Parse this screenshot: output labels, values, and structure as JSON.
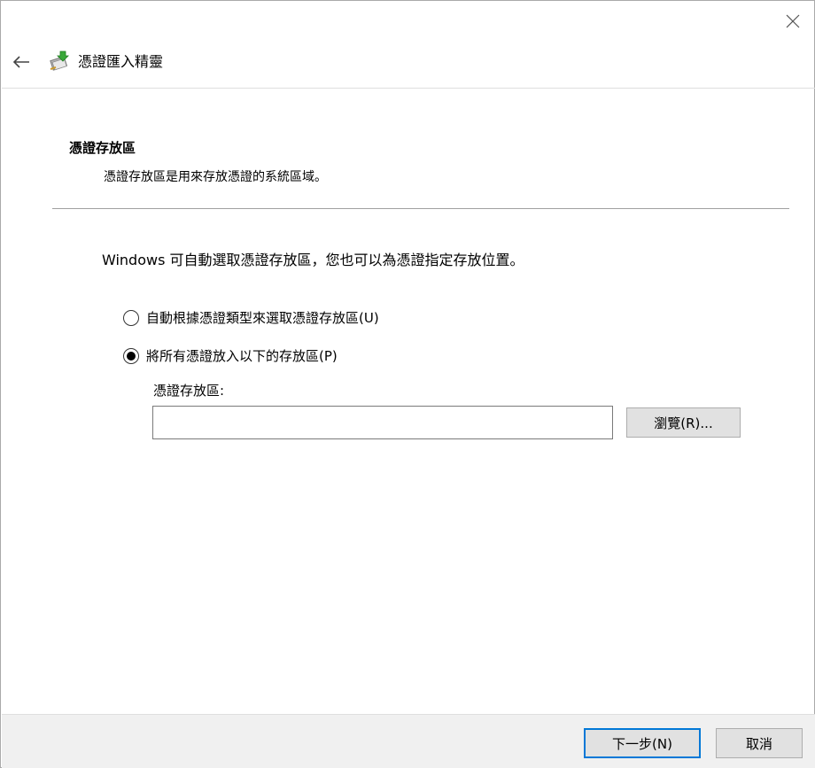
{
  "window": {
    "title": "憑證匯入精靈",
    "icons": {
      "close": "close-icon",
      "back": "back-arrow-icon",
      "wizard": "certificate-import-icon"
    }
  },
  "section": {
    "title": "憑證存放區",
    "description": "憑證存放區是用來存放憑證的系統區域。"
  },
  "intro": "Windows 可自動選取憑證存放區，您也可以為憑證指定存放位置。",
  "options": [
    {
      "label": "自動根據憑證類型來選取憑證存放區(U)",
      "selected": false
    },
    {
      "label": "將所有憑證放入以下的存放區(P)",
      "selected": true
    }
  ],
  "store": {
    "label": "憑證存放區:",
    "value": "",
    "browse_label": "瀏覽(R)..."
  },
  "footer": {
    "next_label": "下一步(N)",
    "cancel_label": "取消"
  },
  "colors": {
    "accent": "#0078d7",
    "footer_bg": "#f0f0f0",
    "button_bg": "#e1e1e1"
  }
}
